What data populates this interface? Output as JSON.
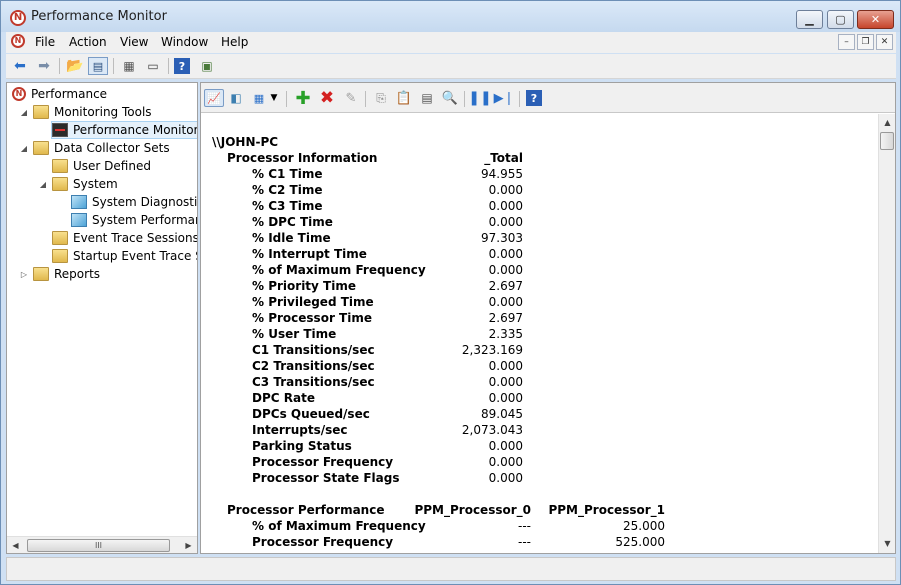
{
  "window": {
    "title": "Performance Monitor"
  },
  "menu": [
    "File",
    "Action",
    "View",
    "Window",
    "Help"
  ],
  "icons": {
    "back": "back-arrow-icon",
    "forward": "forward-arrow-icon",
    "up": "up-folder-icon",
    "console": "show-hide-console-tree-icon",
    "properties": "properties-icon",
    "print": "print-icon",
    "help": "help-icon",
    "action_pane": "action-pane-icon"
  },
  "tree": {
    "root": "Performance",
    "monitoring_tools": "Monitoring Tools",
    "performance_monitor": "Performance Monitor",
    "data_collector_sets": "Data Collector Sets",
    "user_defined": "User Defined",
    "system": "System",
    "system_diagnostics": "System Diagnostics",
    "system_performance": "System Performanc",
    "event_trace_sessions": "Event Trace Sessions",
    "startup_event_trace": "Startup Event Trace Ses",
    "reports": "Reports",
    "scroll_grip": "III"
  },
  "report": {
    "host": "\\\\JOHN-PC",
    "sections": [
      {
        "name": "Processor Information",
        "columns": [
          "_Total"
        ],
        "rows": [
          {
            "label": "% C1 Time",
            "values": [
              "94.955"
            ]
          },
          {
            "label": "% C2 Time",
            "values": [
              "0.000"
            ]
          },
          {
            "label": "% C3 Time",
            "values": [
              "0.000"
            ]
          },
          {
            "label": "% DPC Time",
            "values": [
              "0.000"
            ]
          },
          {
            "label": "% Idle Time",
            "values": [
              "97.303"
            ]
          },
          {
            "label": "% Interrupt Time",
            "values": [
              "0.000"
            ]
          },
          {
            "label": "% of Maximum Frequency",
            "values": [
              "0.000"
            ]
          },
          {
            "label": "% Priority Time",
            "values": [
              "2.697"
            ]
          },
          {
            "label": "% Privileged Time",
            "values": [
              "0.000"
            ]
          },
          {
            "label": "% Processor Time",
            "values": [
              "2.697"
            ]
          },
          {
            "label": "% User Time",
            "values": [
              "2.335"
            ]
          },
          {
            "label": "C1 Transitions/sec",
            "values": [
              "2,323.169"
            ]
          },
          {
            "label": "C2 Transitions/sec",
            "values": [
              "0.000"
            ]
          },
          {
            "label": "C3 Transitions/sec",
            "values": [
              "0.000"
            ]
          },
          {
            "label": "DPC Rate",
            "values": [
              "0.000"
            ]
          },
          {
            "label": "DPCs Queued/sec",
            "values": [
              "89.045"
            ]
          },
          {
            "label": "Interrupts/sec",
            "values": [
              "2,073.043"
            ]
          },
          {
            "label": "Parking Status",
            "values": [
              "0.000"
            ]
          },
          {
            "label": "Processor Frequency",
            "values": [
              "0.000"
            ]
          },
          {
            "label": "Processor State Flags",
            "values": [
              "0.000"
            ]
          }
        ]
      },
      {
        "name": "Processor Performance",
        "columns": [
          "PPM_Processor_0",
          "PPM_Processor_1"
        ],
        "rows": [
          {
            "label": "% of Maximum Frequency",
            "values": [
              "---",
              "25.000"
            ]
          },
          {
            "label": "Processor Frequency",
            "values": [
              "---",
              "525.000"
            ]
          }
        ]
      }
    ]
  }
}
